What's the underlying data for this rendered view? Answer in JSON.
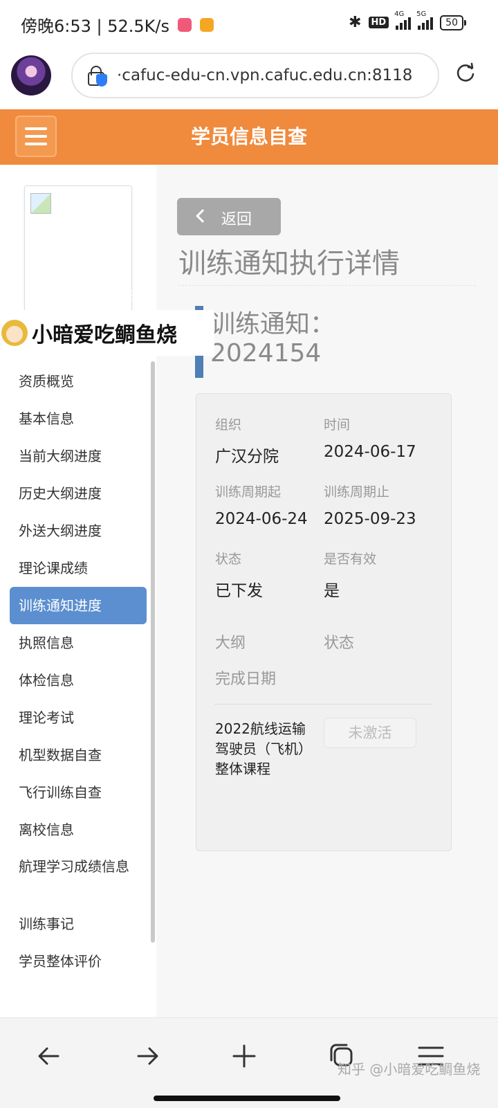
{
  "status_bar": {
    "left_text": "傍晚6:53 | 52.5K/s",
    "network_4g": "4G",
    "network_5g": "5G",
    "hd_badge": "HD",
    "battery": "50",
    "icons": [
      "bluetooth-icon",
      "signal-icon",
      "battery-icon"
    ]
  },
  "browser": {
    "url": "·cafuc-edu-cn.vpn.cafuc.edu.cn:8118"
  },
  "header": {
    "title": "学员信息自查"
  },
  "sidebar": {
    "items": [
      {
        "label": "资质概览"
      },
      {
        "label": "基本信息"
      },
      {
        "label": "当前大纲进度"
      },
      {
        "label": "历史大纲进度"
      },
      {
        "label": "外送大纲进度"
      },
      {
        "label": "理论课成绩"
      },
      {
        "label": "训练通知进度",
        "active": true
      },
      {
        "label": "执照信息"
      },
      {
        "label": "体检信息"
      },
      {
        "label": "理论考试"
      },
      {
        "label": "机型数据自查"
      },
      {
        "label": "飞行训练自查"
      },
      {
        "label": "离校信息"
      },
      {
        "label": "航理学习成绩信息"
      },
      {
        "label": "训练事记"
      },
      {
        "label": "学员整体评价"
      }
    ]
  },
  "main": {
    "back_label": "返回",
    "detail_title": "训练通知执行详情",
    "notice_title_line1": "训练通知：",
    "notice_title_line2": "2024154",
    "card": {
      "org_label": "组织",
      "org_value": "广汉分院",
      "time_label": "时间",
      "time_value": "2024-06-17",
      "start_label": "训练周期起",
      "start_value": "2024-06-24",
      "end_label": "训练周期止",
      "end_value": "2025-09-23",
      "status_label": "状态",
      "status_value": "已下发",
      "valid_label": "是否有效",
      "valid_value": "是",
      "outline_label": "大纲",
      "outline_status_label": "状态",
      "complete_label": "完成日期",
      "course_name": "2022航线运输驾驶员（飞机）整体课程",
      "course_status": "未激活"
    }
  },
  "watermark": {
    "top": "知乎",
    "banner": "小暗爱吃鲷鱼烧",
    "bottom": "知乎 @小暗爱吃鲷鱼烧"
  },
  "colors": {
    "header_orange": "#f08a3c",
    "active_blue": "#5b8fd0",
    "notice_bar_blue": "#4e7fb5"
  }
}
